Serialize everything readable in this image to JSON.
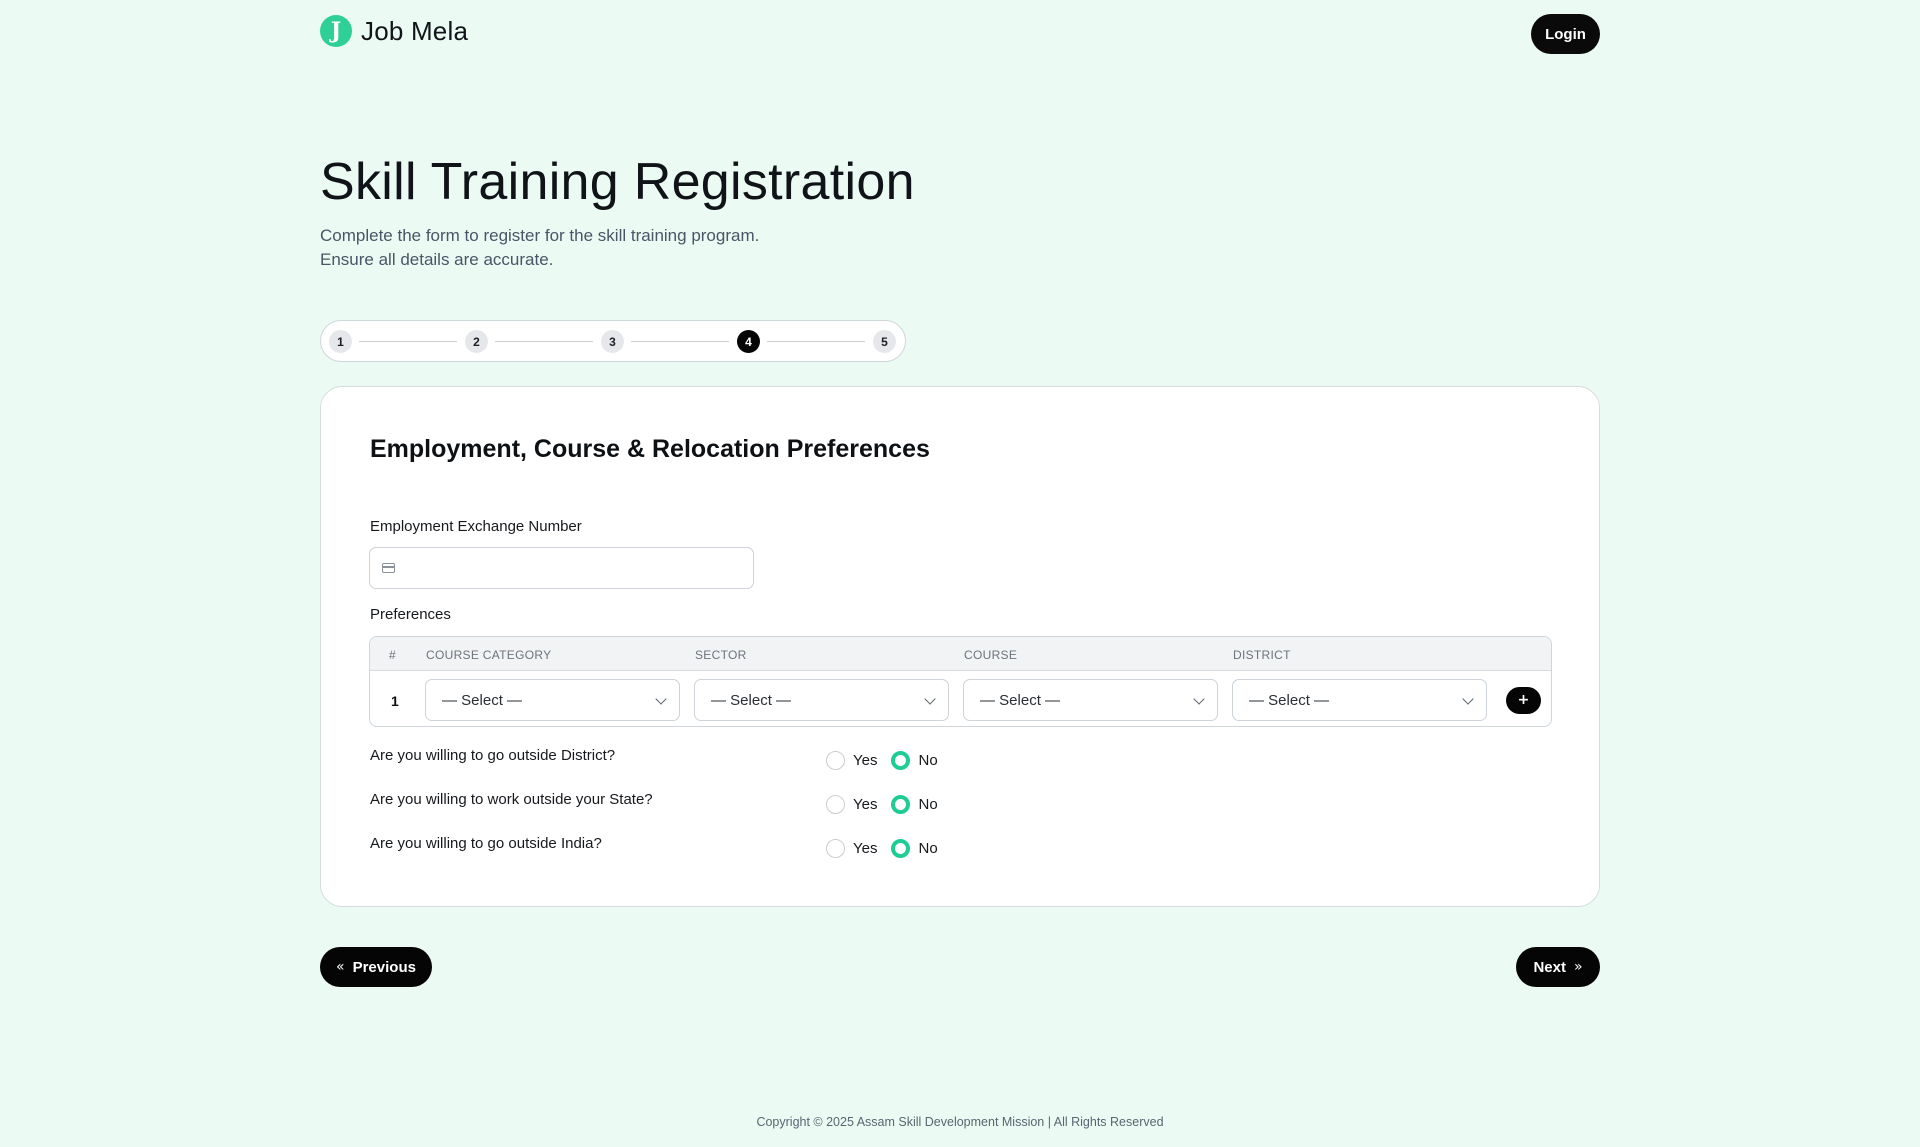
{
  "brand": {
    "logo_letter": "J",
    "name": "Job Mela",
    "accent_color": "#2fcf98"
  },
  "header": {
    "login_label": "Login"
  },
  "page": {
    "title": "Skill Training Registration",
    "subtitle_line1": "Complete the form to register for the skill training program.",
    "subtitle_line2": "Ensure all details are accurate."
  },
  "stepper": {
    "steps": [
      "1",
      "2",
      "3",
      "4",
      "5"
    ],
    "current_step": 4
  },
  "form": {
    "section_title": "Employment, Course & Relocation Preferences",
    "exchange_label": "Employment Exchange Number",
    "exchange_value": "",
    "exchange_icon": "card-icon",
    "preferences_label": "Preferences",
    "table": {
      "headers": [
        "#",
        "COURSE CATEGORY",
        "SECTOR",
        "COURSE",
        "DISTRICT"
      ],
      "rows": [
        {
          "num": "1",
          "course_category": "— Select —",
          "sector": "— Select —",
          "course": "— Select —",
          "district": "— Select —"
        }
      ],
      "add_label": "+"
    },
    "questions": [
      {
        "text": "Are you willing to go outside District?",
        "yes": "Yes",
        "no": "No",
        "selected": "No"
      },
      {
        "text": "Are you willing to work outside your State?",
        "yes": "Yes",
        "no": "No",
        "selected": "No"
      },
      {
        "text": "Are you willing to go outside India?",
        "yes": "Yes",
        "no": "No",
        "selected": "No"
      }
    ]
  },
  "nav": {
    "previous_label": "Previous",
    "next_label": "Next",
    "previous_icon": "«",
    "next_icon": "»"
  },
  "footer": {
    "text": "Copyright © 2025 Assam Skill Development Mission | All Rights Reserved"
  }
}
